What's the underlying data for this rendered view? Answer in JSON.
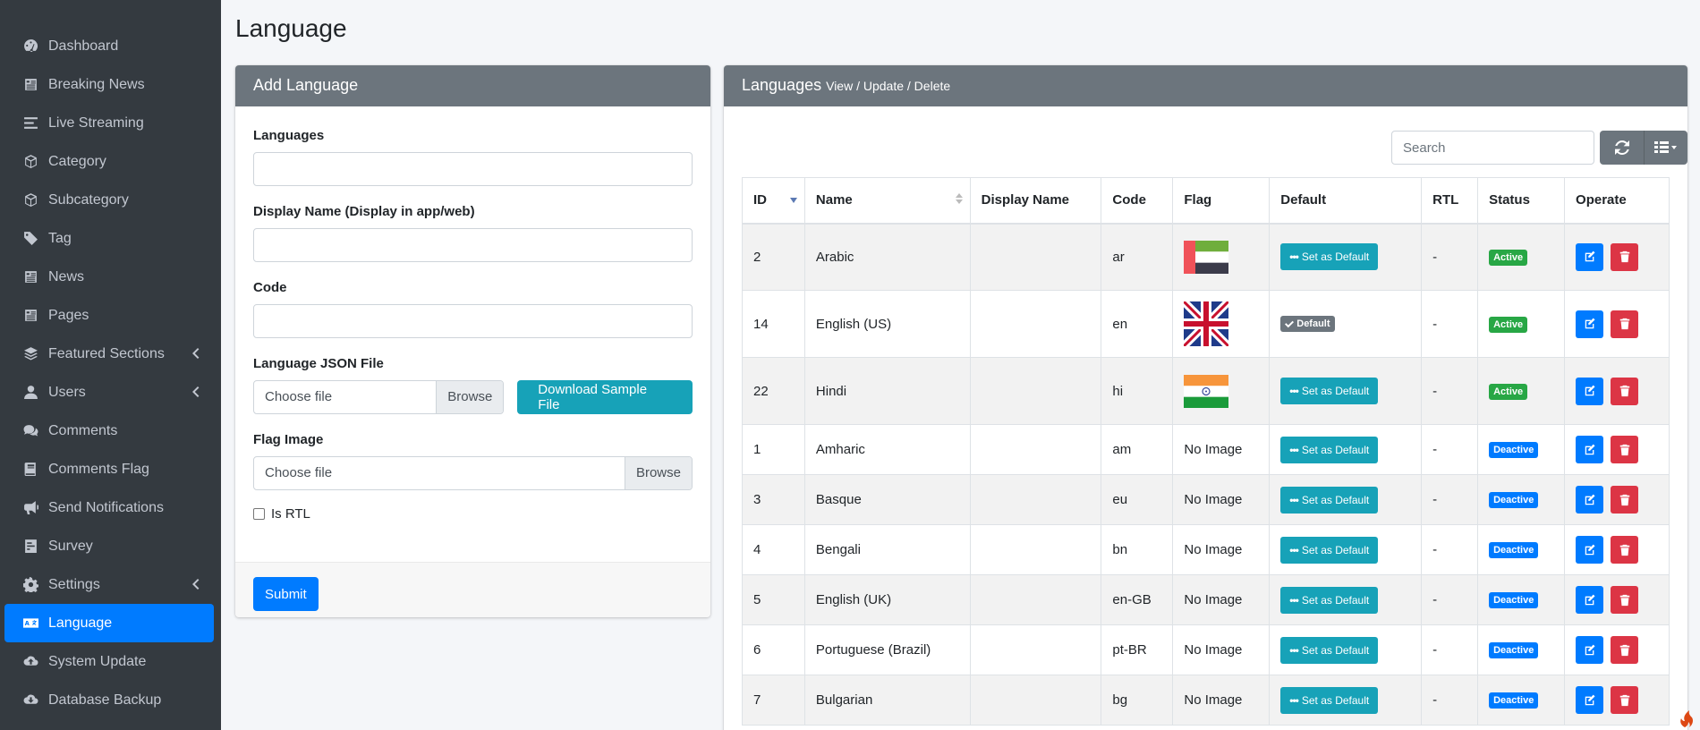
{
  "sidebar": {
    "items": [
      {
        "label": "Dashboard",
        "icon": "dashboard-icon",
        "active": false,
        "has_chevron": false
      },
      {
        "label": "Breaking News",
        "icon": "newspaper-icon",
        "active": false,
        "has_chevron": false
      },
      {
        "label": "Live Streaming",
        "icon": "lines-icon",
        "active": false,
        "has_chevron": false
      },
      {
        "label": "Category",
        "icon": "cube-icon",
        "active": false,
        "has_chevron": false
      },
      {
        "label": "Subcategory",
        "icon": "cubes-icon",
        "active": false,
        "has_chevron": false
      },
      {
        "label": "Tag",
        "icon": "tag-icon",
        "active": false,
        "has_chevron": false
      },
      {
        "label": "News",
        "icon": "newspaper-icon",
        "active": false,
        "has_chevron": false
      },
      {
        "label": "Pages",
        "icon": "newspaper-icon",
        "active": false,
        "has_chevron": false
      },
      {
        "label": "Featured Sections",
        "icon": "layers-icon",
        "active": false,
        "has_chevron": true
      },
      {
        "label": "Users",
        "icon": "user-icon",
        "active": false,
        "has_chevron": true
      },
      {
        "label": "Comments",
        "icon": "comments-icon",
        "active": false,
        "has_chevron": false
      },
      {
        "label": "Comments Flag",
        "icon": "book-icon",
        "active": false,
        "has_chevron": false
      },
      {
        "label": "Send Notifications",
        "icon": "bullhorn-icon",
        "active": false,
        "has_chevron": false
      },
      {
        "label": "Survey",
        "icon": "poll-icon",
        "active": false,
        "has_chevron": false
      },
      {
        "label": "Settings",
        "icon": "gear-icon",
        "active": false,
        "has_chevron": true
      },
      {
        "label": "Language",
        "icon": "language-icon",
        "active": true,
        "has_chevron": false
      },
      {
        "label": "System Update",
        "icon": "cloud-upload-icon",
        "active": false,
        "has_chevron": false
      },
      {
        "label": "Database Backup",
        "icon": "cloud-download-icon",
        "active": false,
        "has_chevron": false
      }
    ]
  },
  "page": {
    "title": "Language"
  },
  "add_form": {
    "header": "Add Language",
    "languages_label": "Languages",
    "display_name_label": "Display Name (Display in app/web)",
    "code_label": "Code",
    "json_file_label": "Language JSON File",
    "choose_file": "Choose file",
    "browse": "Browse",
    "download_sample": "Download Sample File",
    "flag_image_label": "Flag Image",
    "is_rtl_label": "Is RTL",
    "submit": "Submit"
  },
  "list": {
    "header": "Languages",
    "header_small": "View / Update / Delete",
    "search_placeholder": "Search",
    "columns": [
      "ID",
      "Name",
      "Display Name",
      "Code",
      "Flag",
      "Default",
      "RTL",
      "Status",
      "Operate"
    ],
    "set_default_label": "Set as Default",
    "default_label": "Default",
    "no_image": "No Image",
    "rows": [
      {
        "id": "2",
        "name": "Arabic",
        "display_name": "",
        "code": "ar",
        "flag": "uae",
        "is_default": false,
        "rtl": "-",
        "status": "Active"
      },
      {
        "id": "14",
        "name": "English (US)",
        "display_name": "",
        "code": "en",
        "flag": "uk",
        "is_default": true,
        "rtl": "-",
        "status": "Active"
      },
      {
        "id": "22",
        "name": "Hindi",
        "display_name": "",
        "code": "hi",
        "flag": "india",
        "is_default": false,
        "rtl": "-",
        "status": "Active"
      },
      {
        "id": "1",
        "name": "Amharic",
        "display_name": "",
        "code": "am",
        "flag": "",
        "is_default": false,
        "rtl": "-",
        "status": "Deactive"
      },
      {
        "id": "3",
        "name": "Basque",
        "display_name": "",
        "code": "eu",
        "flag": "",
        "is_default": false,
        "rtl": "-",
        "status": "Deactive"
      },
      {
        "id": "4",
        "name": "Bengali",
        "display_name": "",
        "code": "bn",
        "flag": "",
        "is_default": false,
        "rtl": "-",
        "status": "Deactive"
      },
      {
        "id": "5",
        "name": "English (UK)",
        "display_name": "",
        "code": "en-GB",
        "flag": "",
        "is_default": false,
        "rtl": "-",
        "status": "Deactive"
      },
      {
        "id": "6",
        "name": "Portuguese (Brazil)",
        "display_name": "",
        "code": "pt-BR",
        "flag": "",
        "is_default": false,
        "rtl": "-",
        "status": "Deactive"
      },
      {
        "id": "7",
        "name": "Bulgarian",
        "display_name": "",
        "code": "bg",
        "flag": "",
        "is_default": false,
        "rtl": "-",
        "status": "Deactive"
      }
    ]
  },
  "colors": {
    "sidebar_bg": "#343a40",
    "active": "#007bff",
    "info": "#17a2b8",
    "success": "#28a745",
    "danger": "#dc3545",
    "header_gray": "#6c757d"
  }
}
